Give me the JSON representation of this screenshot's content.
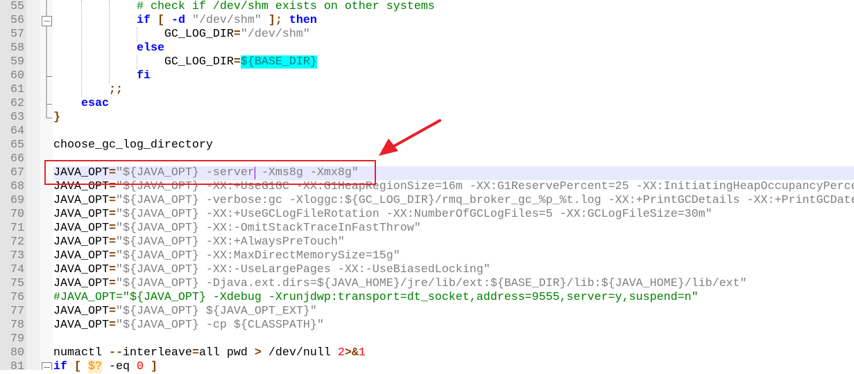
{
  "editor": {
    "current_line": 67,
    "caret_after_text": "JAVA_OPT=\"${JAVA_OPT} -server",
    "annotation_color": "#e8202a",
    "lines": [
      {
        "n": "55",
        "t": [
          [
            "t",
            "            "
          ],
          [
            "c",
            "# check if /dev/shm exists on other systems"
          ]
        ]
      },
      {
        "n": "56",
        "t": [
          [
            "t",
            "            "
          ],
          [
            "k",
            "if"
          ],
          [
            "t",
            " "
          ],
          [
            "o",
            "["
          ],
          [
            "t",
            " "
          ],
          [
            "k",
            "-d"
          ],
          [
            "t",
            " "
          ],
          [
            "s",
            "\"/dev/shm\""
          ],
          [
            "t",
            " "
          ],
          [
            "o",
            "];"
          ],
          [
            "t",
            " "
          ],
          [
            "k",
            "then"
          ]
        ]
      },
      {
        "n": "57",
        "t": [
          [
            "t",
            "                GC_LOG_DIR"
          ],
          [
            "o",
            "="
          ],
          [
            "s",
            "\"/dev/shm\""
          ]
        ]
      },
      {
        "n": "58",
        "t": [
          [
            "t",
            "            "
          ],
          [
            "k",
            "else"
          ]
        ]
      },
      {
        "n": "59",
        "t": [
          [
            "t",
            "                GC_LOG_DIR"
          ],
          [
            "o",
            "="
          ],
          [
            "h",
            "${BASE_DIR}"
          ]
        ]
      },
      {
        "n": "60",
        "t": [
          [
            "t",
            "            "
          ],
          [
            "k",
            "fi"
          ]
        ]
      },
      {
        "n": "61",
        "t": [
          [
            "t",
            "        "
          ],
          [
            "o",
            ";;"
          ]
        ]
      },
      {
        "n": "62",
        "t": [
          [
            "t",
            "    "
          ],
          [
            "k",
            "esac"
          ]
        ]
      },
      {
        "n": "63",
        "t": [
          [
            "o",
            "}"
          ]
        ]
      },
      {
        "n": "64",
        "t": []
      },
      {
        "n": "65",
        "t": [
          [
            "t",
            "choose_gc_log_directory"
          ]
        ]
      },
      {
        "n": "66",
        "t": []
      },
      {
        "n": "67",
        "t": [
          [
            "t",
            "JAVA_OPT"
          ],
          [
            "o",
            "="
          ],
          [
            "s",
            "\"${JAVA_OPT} -server -Xms8g -Xmx8g\""
          ]
        ]
      },
      {
        "n": "68",
        "t": [
          [
            "t",
            "JAVA_OPT"
          ],
          [
            "o",
            "="
          ],
          [
            "s",
            "\"${JAVA_OPT} -XX:+UseG1GC -XX:G1HeapRegionSize=16m -XX:G1ReservePercent=25 -XX:InitiatingHeapOccupancyPerce"
          ]
        ]
      },
      {
        "n": "69",
        "t": [
          [
            "t",
            "JAVA_OPT"
          ],
          [
            "o",
            "="
          ],
          [
            "s",
            "\"${JAVA_OPT} -verbose:gc -Xloggc:${GC_LOG_DIR}/rmq_broker_gc_%p_%t.log -XX:+PrintGCDetails -XX:+PrintGCDate"
          ]
        ]
      },
      {
        "n": "70",
        "t": [
          [
            "t",
            "JAVA_OPT"
          ],
          [
            "o",
            "="
          ],
          [
            "s",
            "\"${JAVA_OPT} -XX:+UseGCLogFileRotation -XX:NumberOfGCLogFiles=5 -XX:GCLogFileSize=30m\""
          ]
        ]
      },
      {
        "n": "71",
        "t": [
          [
            "t",
            "JAVA_OPT"
          ],
          [
            "o",
            "="
          ],
          [
            "s",
            "\"${JAVA_OPT} -XX:-OmitStackTraceInFastThrow\""
          ]
        ]
      },
      {
        "n": "72",
        "t": [
          [
            "t",
            "JAVA_OPT"
          ],
          [
            "o",
            "="
          ],
          [
            "s",
            "\"${JAVA_OPT} -XX:+AlwaysPreTouch\""
          ]
        ]
      },
      {
        "n": "73",
        "t": [
          [
            "t",
            "JAVA_OPT"
          ],
          [
            "o",
            "="
          ],
          [
            "s",
            "\"${JAVA_OPT} -XX:MaxDirectMemorySize=15g\""
          ]
        ]
      },
      {
        "n": "74",
        "t": [
          [
            "t",
            "JAVA_OPT"
          ],
          [
            "o",
            "="
          ],
          [
            "s",
            "\"${JAVA_OPT} -XX:-UseLargePages -XX:-UseBiasedLocking\""
          ]
        ]
      },
      {
        "n": "75",
        "t": [
          [
            "t",
            "JAVA_OPT"
          ],
          [
            "o",
            "="
          ],
          [
            "s",
            "\"${JAVA_OPT} -Djava.ext.dirs=${JAVA_HOME}/jre/lib/ext:${BASE_DIR}/lib:${JAVA_HOME}/lib/ext\""
          ]
        ]
      },
      {
        "n": "76",
        "t": [
          [
            "c",
            "#JAVA_OPT=\"${JAVA_OPT} -Xdebug -Xrunjdwp:transport=dt_socket,address=9555,server=y,suspend=n\""
          ]
        ]
      },
      {
        "n": "77",
        "t": [
          [
            "t",
            "JAVA_OPT"
          ],
          [
            "o",
            "="
          ],
          [
            "s",
            "\"${JAVA_OPT} ${JAVA_OPT_EXT}\""
          ]
        ]
      },
      {
        "n": "78",
        "t": [
          [
            "t",
            "JAVA_OPT"
          ],
          [
            "o",
            "="
          ],
          [
            "s",
            "\"${JAVA_OPT} -cp ${CLASSPATH}\""
          ]
        ]
      },
      {
        "n": "79",
        "t": []
      },
      {
        "n": "80",
        "t": [
          [
            "t",
            "numactl "
          ],
          [
            "o",
            "--"
          ],
          [
            "t",
            "interleave"
          ],
          [
            "o",
            "="
          ],
          [
            "t",
            "all pwd "
          ],
          [
            "o",
            ">"
          ],
          [
            "t",
            " /dev/null "
          ],
          [
            "n",
            "2"
          ],
          [
            "o",
            ">&"
          ],
          [
            "n",
            "1"
          ]
        ]
      },
      {
        "n": "81",
        "t": [
          [
            "k",
            "if"
          ],
          [
            "t",
            " "
          ],
          [
            "o",
            "["
          ],
          [
            "t",
            " "
          ],
          [
            "v",
            "$?"
          ],
          [
            "t",
            " -eq "
          ],
          [
            "n",
            "0"
          ],
          [
            "t",
            " "
          ],
          [
            "o",
            "]"
          ]
        ]
      }
    ]
  }
}
